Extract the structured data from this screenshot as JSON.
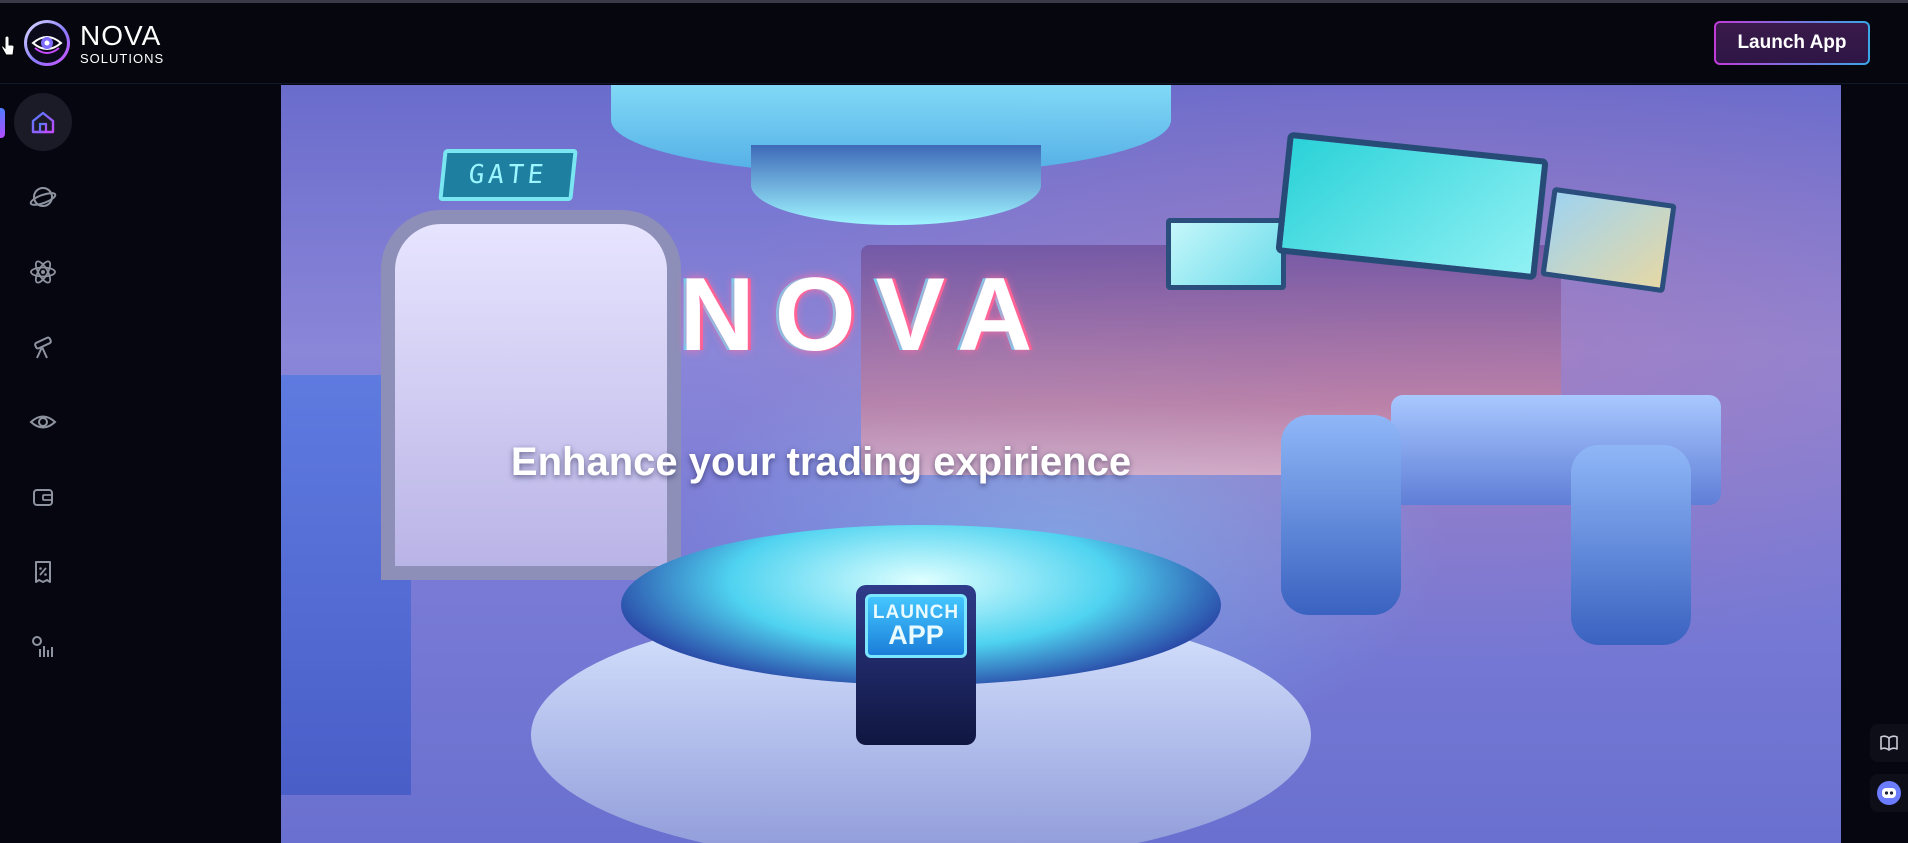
{
  "brand": {
    "name": "NOVA",
    "subtitle": "SOLUTIONS",
    "logo_icon": "nova-eye-logo-icon"
  },
  "header": {
    "launch_label": "Launch App"
  },
  "sidebar": {
    "items": [
      {
        "id": "home",
        "icon": "home-icon",
        "active": true
      },
      {
        "id": "planet",
        "icon": "planet-icon",
        "active": false
      },
      {
        "id": "atom",
        "icon": "atom-icon",
        "active": false
      },
      {
        "id": "telescope",
        "icon": "telescope-icon",
        "active": false
      },
      {
        "id": "eye",
        "icon": "eye-icon",
        "active": false
      },
      {
        "id": "wallet",
        "icon": "wallet-icon",
        "active": false
      },
      {
        "id": "receipt",
        "icon": "receipt-percent-icon",
        "active": false
      },
      {
        "id": "stats",
        "icon": "stats-icon",
        "active": false
      }
    ]
  },
  "hero": {
    "title": "NOVA",
    "subtitle": "Enhance your trading expirience",
    "gate_sign": "GATE",
    "terminal_line1": "LAUNCH",
    "terminal_line2": "APP"
  },
  "floating": [
    {
      "icon": "book-icon"
    },
    {
      "icon": "chat-bot-icon"
    }
  ],
  "colors": {
    "background": "#060611",
    "accent_purple": "#c23bd9",
    "accent_blue": "#39a7e6",
    "icon_gray": "#9aa0ad",
    "active_icon": "#a74bff"
  }
}
